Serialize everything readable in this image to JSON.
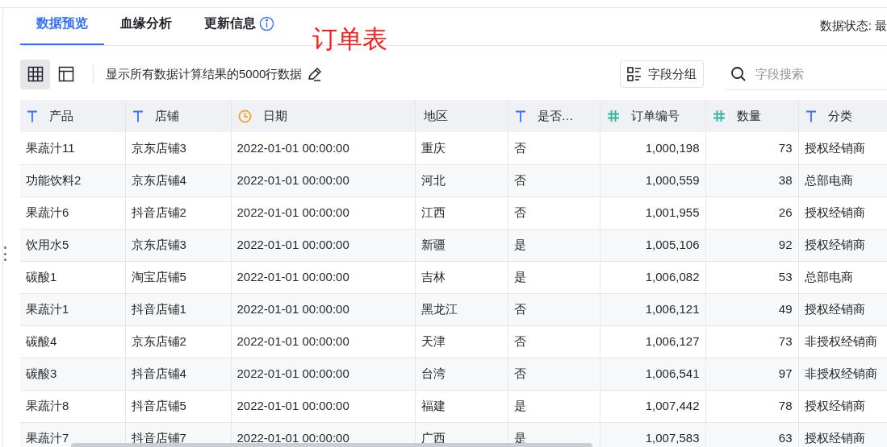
{
  "tabs": [
    {
      "label": "数据预览",
      "selected": true
    },
    {
      "label": "血缘分析",
      "selected": false
    },
    {
      "label": "更新信息",
      "selected": false,
      "info": true
    }
  ],
  "overlay_title": "订单表",
  "data_status": "数据状态: 最",
  "toolbar": {
    "views": [
      {
        "kind": "grid",
        "selected": true
      },
      {
        "kind": "layout",
        "selected": false
      }
    ],
    "summary": "显示所有数据计算结果的5000行数据",
    "group_button": "字段分组",
    "search": {
      "placeholder": "字段搜索"
    }
  },
  "table": {
    "columns": [
      {
        "label": "产品",
        "kind": "text"
      },
      {
        "label": "店铺",
        "kind": "text"
      },
      {
        "label": "日期",
        "kind": "date"
      },
      {
        "label": "地区",
        "kind": "plain"
      },
      {
        "label": "是否…",
        "kind": "text"
      },
      {
        "label": "订单编号",
        "kind": "number"
      },
      {
        "label": "数量",
        "kind": "number"
      },
      {
        "label": "分类",
        "kind": "text"
      }
    ],
    "rows": [
      [
        "果蔬汁11",
        "京东店铺3",
        "2022-01-01 00:00:00",
        "重庆",
        "否",
        "1,000,198",
        "73",
        "授权经销商"
      ],
      [
        "功能饮料2",
        "京东店铺4",
        "2022-01-01 00:00:00",
        "河北",
        "否",
        "1,000,559",
        "38",
        "总部电商"
      ],
      [
        "果蔬汁6",
        "抖音店铺2",
        "2022-01-01 00:00:00",
        "江西",
        "否",
        "1,001,955",
        "26",
        "授权经销商"
      ],
      [
        "饮用水5",
        "京东店铺3",
        "2022-01-01 00:00:00",
        "新疆",
        "是",
        "1,005,106",
        "92",
        "授权经销商"
      ],
      [
        "碳酸1",
        "淘宝店铺5",
        "2022-01-01 00:00:00",
        "吉林",
        "是",
        "1,006,082",
        "53",
        "总部电商"
      ],
      [
        "果蔬汁1",
        "抖音店铺1",
        "2022-01-01 00:00:00",
        "黑龙江",
        "否",
        "1,006,121",
        "49",
        "授权经销商"
      ],
      [
        "碳酸4",
        "京东店铺2",
        "2022-01-01 00:00:00",
        "天津",
        "否",
        "1,006,127",
        "73",
        "非授权经销商"
      ],
      [
        "碳酸3",
        "抖音店铺4",
        "2022-01-01 00:00:00",
        "台湾",
        "否",
        "1,006,541",
        "97",
        "非授权经销商"
      ],
      [
        "果蔬汁8",
        "抖音店铺5",
        "2022-01-01 00:00:00",
        "福建",
        "是",
        "1,007,442",
        "78",
        "授权经销商"
      ],
      [
        "果蔬汁7",
        "抖音店铺7",
        "2022-01-01 00:00:00",
        "广西",
        "是",
        "1,007,583",
        "63",
        "授权经销商"
      ]
    ]
  }
}
